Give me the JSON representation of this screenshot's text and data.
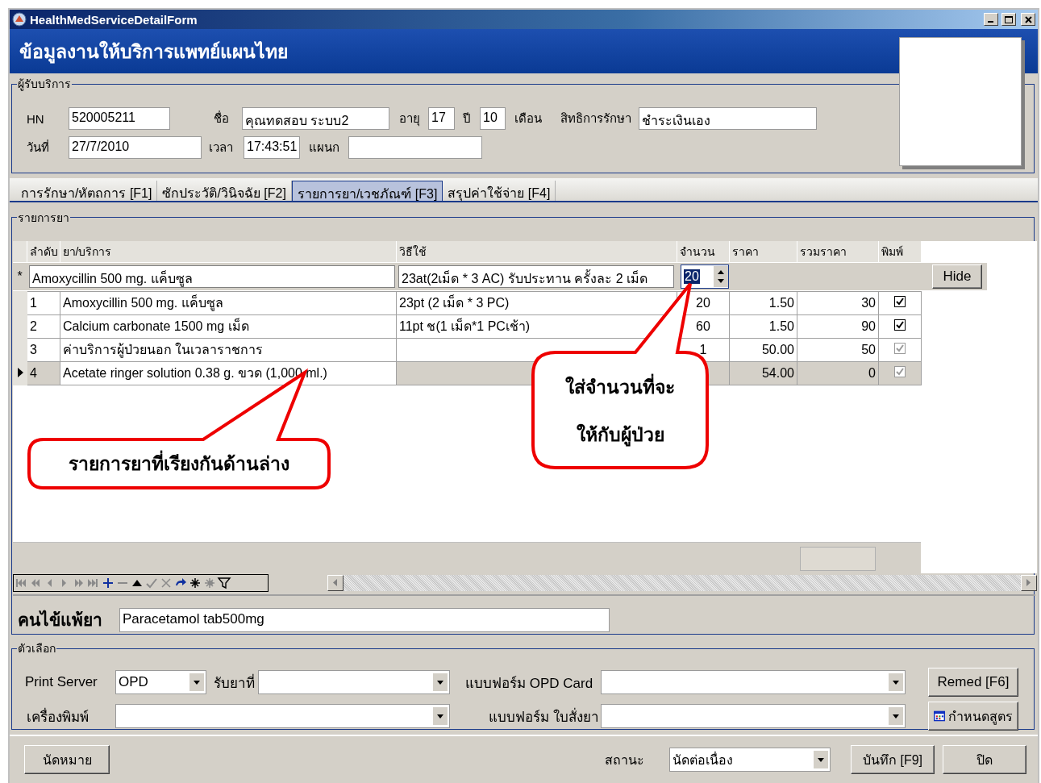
{
  "window": {
    "title": "HealthMedServiceDetailForm"
  },
  "header": {
    "title": "ข้อมูลงานให้บริการแพทย์แผนไทย"
  },
  "patient": {
    "legend": "ผู้รับบริการ",
    "hn": {
      "label": "HN",
      "value": "520005211"
    },
    "name": {
      "label": "ชื่อ",
      "value": "คุณทดสอบ ระบบ2"
    },
    "age": {
      "label": "อายุ",
      "years": "17",
      "years_unit": "ปี",
      "months": "10",
      "months_unit": "เดือน"
    },
    "coverage": {
      "label": "สิทธิการรักษา",
      "value": "ชำระเงินเอง"
    },
    "date": {
      "label": "วันที่",
      "value": "27/7/2010"
    },
    "time": {
      "label": "เวลา",
      "value": "17:43:51"
    },
    "department": {
      "label": "แผนก"
    }
  },
  "tabs": [
    {
      "label": "การรักษา/หัตถการ [F1]",
      "selected": false
    },
    {
      "label": "ซักประวัติ/วินิจฉัย [F2]",
      "selected": false
    },
    {
      "label": "รายการยา/เวชภัณฑ์ [F3]",
      "selected": true
    },
    {
      "label": "สรุปค่าใช้จ่าย [F4]",
      "selected": false
    }
  ],
  "drugs": {
    "legend": "รายการยา",
    "columns": [
      "ลำดับ",
      "ยา/บริการ",
      "วิธีใช้",
      "จำนวน",
      "ราคา",
      "รวมราคา",
      "พิมพ์"
    ],
    "edit_row": {
      "marker": "*",
      "drug": "Amoxycillin 500 mg. แค็บซูล",
      "usage": "23at(2เม็ด * 3 AC)  รับประทาน ครั้งละ 2 เม็ด",
      "quantity": "20",
      "button": "Hide"
    },
    "rows": [
      {
        "current": false,
        "no": "1",
        "drug": "Amoxycillin 500 mg. แค็บซูล",
        "usage": "23pt (2 เม็ด * 3 PC)",
        "quantity": "20",
        "price": "1.50",
        "total": "30",
        "checked": true,
        "disabled": false
      },
      {
        "current": false,
        "no": "2",
        "drug": "Calcium  carbonate 1500 mg เม็ด",
        "usage": "11pt ช(1 เม็ด*1 PCเช้า)",
        "quantity": "60",
        "price": "1.50",
        "total": "90",
        "checked": true,
        "disabled": false
      },
      {
        "current": false,
        "no": "3",
        "drug": "ค่าบริการผู้ป่วยนอก ในเวลาราชการ",
        "quantity": "1",
        "price": "50.00",
        "total": "50",
        "checked": true,
        "disabled": true
      },
      {
        "current": true,
        "no": "4",
        "drug": "Acetate ringer solution 0.38 g. ขวด (1,000 ml.)",
        "price": "54.00",
        "total": "0",
        "checked": true,
        "disabled": true
      }
    ]
  },
  "allergy": {
    "label": "คนไข้แพ้ยา",
    "value": "Paracetamol  tab500mg"
  },
  "options": {
    "legend": "ตัวเลือก",
    "print_server": {
      "label": "Print Server",
      "value": "OPD"
    },
    "pickup": {
      "label": "รับยาที่"
    },
    "opd_card_form": {
      "label": "แบบฟอร์ม OPD Card"
    },
    "printer": {
      "label": "เครื่องพิมพ์"
    },
    "rx_form": {
      "label": "แบบฟอร์ม ใบสั่งยา"
    },
    "buttons": [
      "Remed [F6]",
      "กำหนดสูตร"
    ]
  },
  "footer": {
    "appointment_button": "นัดหมาย",
    "status_label": "สถานะ",
    "status_value": "นัดต่อเนื่อง",
    "buttons": [
      "บันทึก [F9]",
      "ปิด"
    ]
  },
  "callouts": [
    {
      "lines": [
        "รายการยาที่เรียงกันด้านล่าง"
      ]
    },
    {
      "lines": [
        "ใส่จำนวนที่จะ",
        "ให้กับผู้ป่วย"
      ]
    }
  ]
}
